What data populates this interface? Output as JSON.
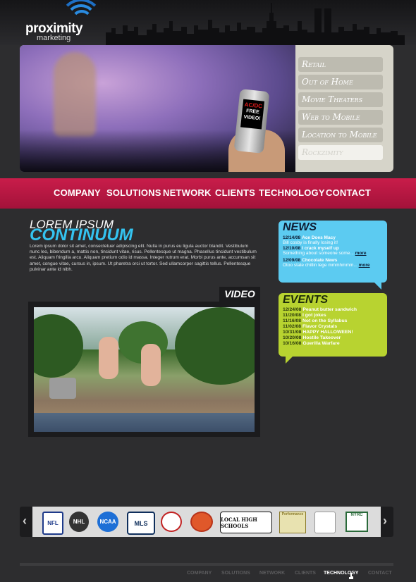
{
  "logo": {
    "name": "proximity",
    "sub": "marketing"
  },
  "hero": {
    "phone_band": "AC/DC",
    "phone_text": "FREE VIDEO!",
    "menu": [
      {
        "label": "Retail"
      },
      {
        "label": "Out of Home"
      },
      {
        "label": "Movie Theaters"
      },
      {
        "label": "Web to Mobile"
      },
      {
        "label": "Location to Mobile"
      },
      {
        "label": "Rockzimity"
      }
    ]
  },
  "nav": {
    "items": [
      "COMPANY",
      "SOLUTIONS",
      "NETWORK",
      "CLIENTS",
      "TECHNOLOGY",
      "CONTACT"
    ]
  },
  "intro": {
    "title_line1": "LOREM IPSUM",
    "title_line2": "CONTINUUM",
    "body": "Lorem ipsum dolor sit amet, consectetuer adipiscing elit. Nulla in purus eu ligula auctor blandit. Vestibulum nunc leo, bibendum a, mattis non, tincidunt vitae, risus. Pellentesque ut magna. Phasellus tincidunt vestibulum est. Aliquam fringilla arcu. Aliquam pretium odio id massa. Integer rutrum erat. Morbi purus ante, accumsan sit amet, congue vitae, cursus in, ipsum. Ut pharetra orci ut tortor. Sed ullamcorper sagittis tellus. Pellentesque pulvinar ante id nibh."
  },
  "video": {
    "label": "VIDEO"
  },
  "news": {
    "title": "NEWS",
    "items": [
      {
        "date": "12/14/08",
        "title": "Ace Does Macy",
        "summary": "Bill cosby is finally losing it!",
        "more": ""
      },
      {
        "date": "12/10/08",
        "title": "I crack myself up",
        "summary": "Something about someone some...",
        "more": "more"
      },
      {
        "date": "12/09/08",
        "title": "Chocolate News",
        "summary": "Otoo state chitlin lege mmmhmmm...",
        "more": "more"
      }
    ]
  },
  "events": {
    "title": "EVENTS",
    "items": [
      {
        "date": "12/24/08",
        "title": "Peanut butter sandwich"
      },
      {
        "date": "11/20/08",
        "title": "I got jokes"
      },
      {
        "date": "11/16/08",
        "title": "Not on the Syllabus"
      },
      {
        "date": "11/02/08",
        "title": "Flavor Crystals"
      },
      {
        "date": "10/31/08",
        "title": "HAPPY HALLOWEEN!"
      },
      {
        "date": "10/20/08",
        "title": "Hostile Takeover"
      },
      {
        "date": "10/16/08",
        "title": "Guerilla Warfare"
      }
    ]
  },
  "clients": {
    "prev": "‹",
    "next": "›",
    "logos": [
      {
        "name": "NFL",
        "color": "#1e3a8a"
      },
      {
        "name": "NHL",
        "color": "#333333"
      },
      {
        "name": "NCAA",
        "color": "#1d6fd6"
      },
      {
        "name": "MLS",
        "color": "#0f2f5c"
      },
      {
        "name": "",
        "color": "#c22222"
      },
      {
        "name": "",
        "color": "#e0582a"
      },
      {
        "name": "LOCAL HIGH SCHOOLS",
        "color": "#111111"
      },
      {
        "name": "Performance",
        "color": "#8a7a2a"
      },
      {
        "name": "",
        "color": "#8a1a1a"
      },
      {
        "name": "NYRC",
        "color": "#2a6a3a"
      }
    ]
  },
  "footer": {
    "items": [
      "COMPANY",
      "SOLUTIONS",
      "NETWORK",
      "CLIENTS",
      "TECHNOLOGY",
      "CONTACT"
    ],
    "active": "TECHNOLOGY"
  }
}
